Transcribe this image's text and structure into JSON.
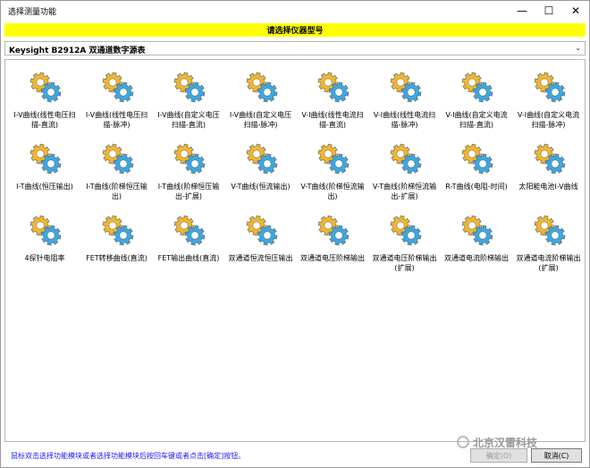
{
  "window": {
    "title": "选择测量功能",
    "minimize_glyph": "—",
    "maximize_glyph": "☐",
    "close_glyph": "✕"
  },
  "banner": {
    "text": "请选择仪器型号"
  },
  "model_select": {
    "value": "Keysight B2912A 双通道数字源表",
    "arrow_glyph": "⌄"
  },
  "icon": {
    "name": "gears-icon",
    "colors": {
      "gold": "#f5b72a",
      "blue": "#3aa8e4"
    }
  },
  "functions": [
    {
      "label1": "I-V曲线(线性电压扫",
      "label2": "描-直流)"
    },
    {
      "label1": "I-V曲线(线性电压扫",
      "label2": "描-脉冲)"
    },
    {
      "label1": "I-V曲线(自定义电压",
      "label2": "扫描-直流)"
    },
    {
      "label1": "I-V曲线(自定义电压",
      "label2": "扫描-脉冲)"
    },
    {
      "label1": "V-I曲线(线性电流扫",
      "label2": "描-直流)"
    },
    {
      "label1": "V-I曲线(线性电流扫",
      "label2": "描-脉冲)"
    },
    {
      "label1": "V-I曲线(自定义电流",
      "label2": "扫描-直流)"
    },
    {
      "label1": "V-I曲线(自定义电流",
      "label2": "扫描-脉冲)"
    },
    {
      "label1": "I-T曲线(恒压输出)",
      "label2": ""
    },
    {
      "label1": "I-T曲线(阶梯恒压输",
      "label2": "出)"
    },
    {
      "label1": "I-T曲线(阶梯恒压输",
      "label2": "出-扩展)"
    },
    {
      "label1": "V-T曲线(恒流输出)",
      "label2": ""
    },
    {
      "label1": "V-T曲线(阶梯恒流输",
      "label2": "出)"
    },
    {
      "label1": "V-T曲线(阶梯恒流输",
      "label2": "出-扩展)"
    },
    {
      "label1": "R-T曲线(电阻-时间)",
      "label2": ""
    },
    {
      "label1": "太阳能电池I-V曲线",
      "label2": ""
    },
    {
      "label1": "4探针电阻率",
      "label2": ""
    },
    {
      "label1": "FET转移曲线(直流)",
      "label2": ""
    },
    {
      "label1": "FET输出曲线(直流)",
      "label2": ""
    },
    {
      "label1": "双通道恒流恒压输出",
      "label2": ""
    },
    {
      "label1": "双通道电压阶梯输出",
      "label2": ""
    },
    {
      "label1": "双通道电压阶梯输出",
      "label2": "(扩展)"
    },
    {
      "label1": "双通道电流阶梯输出",
      "label2": ""
    },
    {
      "label1": "双通道电流阶梯输出",
      "label2": "(扩展)"
    }
  ],
  "status": {
    "text": "鼠标双击选择功能模块或者选择功能模块后按回车键或者点击[确定]按钮。"
  },
  "watermark": {
    "text": "北京汉雷科技"
  },
  "buttons": {
    "ok_label": "确定(O)",
    "cancel_label": "取消(C)"
  }
}
